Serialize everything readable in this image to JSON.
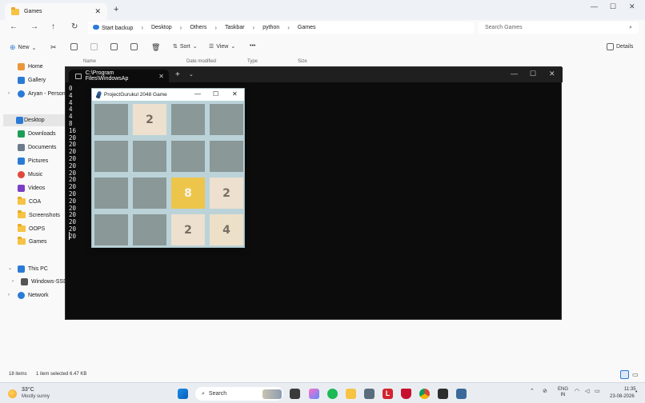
{
  "explorer": {
    "tab_title": "Games",
    "breadcrumbs": [
      "Start backup",
      "Desktop",
      "Others",
      "Taskbar",
      "python",
      "Games"
    ],
    "search_placeholder": "Search Games",
    "toolbar": {
      "new_label": "New",
      "sort_label": "Sort",
      "view_label": "View",
      "more_label": "•••",
      "details_label": "Details"
    },
    "columns": [
      "Name",
      "Date modified",
      "Type",
      "Size"
    ],
    "sidebar": [
      {
        "label": "Home",
        "icon": "home-icon",
        "color": "#e8973a"
      },
      {
        "label": "Gallery",
        "icon": "gallery-icon",
        "color": "#2b7bd6"
      },
      {
        "label": "Aryan - Personal",
        "icon": "cloud-icon",
        "color": "#2b7bd6"
      },
      {
        "label": "Desktop",
        "icon": "desktop-icon",
        "color": "#2b7bd6"
      },
      {
        "label": "Downloads",
        "icon": "downloads-icon",
        "color": "#1e9e55"
      },
      {
        "label": "Documents",
        "icon": "documents-icon",
        "color": "#6b7b8c"
      },
      {
        "label": "Pictures",
        "icon": "pictures-icon",
        "color": "#2b7bd6"
      },
      {
        "label": "Music",
        "icon": "music-icon",
        "color": "#e0483c"
      },
      {
        "label": "Videos",
        "icon": "videos-icon",
        "color": "#7a3fc4"
      },
      {
        "label": "COA",
        "icon": "folder-icon",
        "color": "#f6c344"
      },
      {
        "label": "Screenshots",
        "icon": "folder-icon",
        "color": "#f6c344"
      },
      {
        "label": "OOPS",
        "icon": "folder-icon",
        "color": "#f6c344"
      },
      {
        "label": "Games",
        "icon": "folder-icon",
        "color": "#f6c344"
      },
      {
        "label": "This PC",
        "icon": "pc-icon",
        "color": "#2b7bd6"
      },
      {
        "label": "Windows-SSD (",
        "icon": "drive-icon",
        "color": "#555555"
      },
      {
        "label": "Network",
        "icon": "network-icon",
        "color": "#2b7bd6"
      }
    ],
    "status_items": "18 items",
    "status_selected": "1 item selected  6.47 KB"
  },
  "terminal": {
    "tab_title": "C:\\Program Files\\WindowsAp",
    "lines": [
      "0",
      "4",
      "4",
      "4",
      "4",
      "8",
      "16",
      "20",
      "20",
      "20",
      "20",
      "20",
      "20",
      "20",
      "20",
      "20",
      "20",
      "20",
      "20",
      "20",
      "20",
      "20"
    ]
  },
  "game": {
    "title": "ProjectGurukul 2048 Game",
    "tiles": [
      [
        "",
        "2",
        "",
        ""
      ],
      [
        "",
        "",
        "",
        ""
      ],
      [
        "",
        "",
        "8",
        "2"
      ],
      [
        "",
        "",
        "2",
        "4"
      ]
    ],
    "colors": {
      "empty": "#8a9898",
      "2": "#ede0cf",
      "4": "#ede0c8",
      "8": "#edc54a",
      "text_dark": "#776e65",
      "text_light": "#f9f6f2"
    }
  },
  "taskbar": {
    "temp": "33°C",
    "weather": "Mostly sunny",
    "search_label": "Search",
    "lang_top": "ENG",
    "lang_bottom": "IN",
    "time": "11:35",
    "date": "23-08-2026"
  }
}
